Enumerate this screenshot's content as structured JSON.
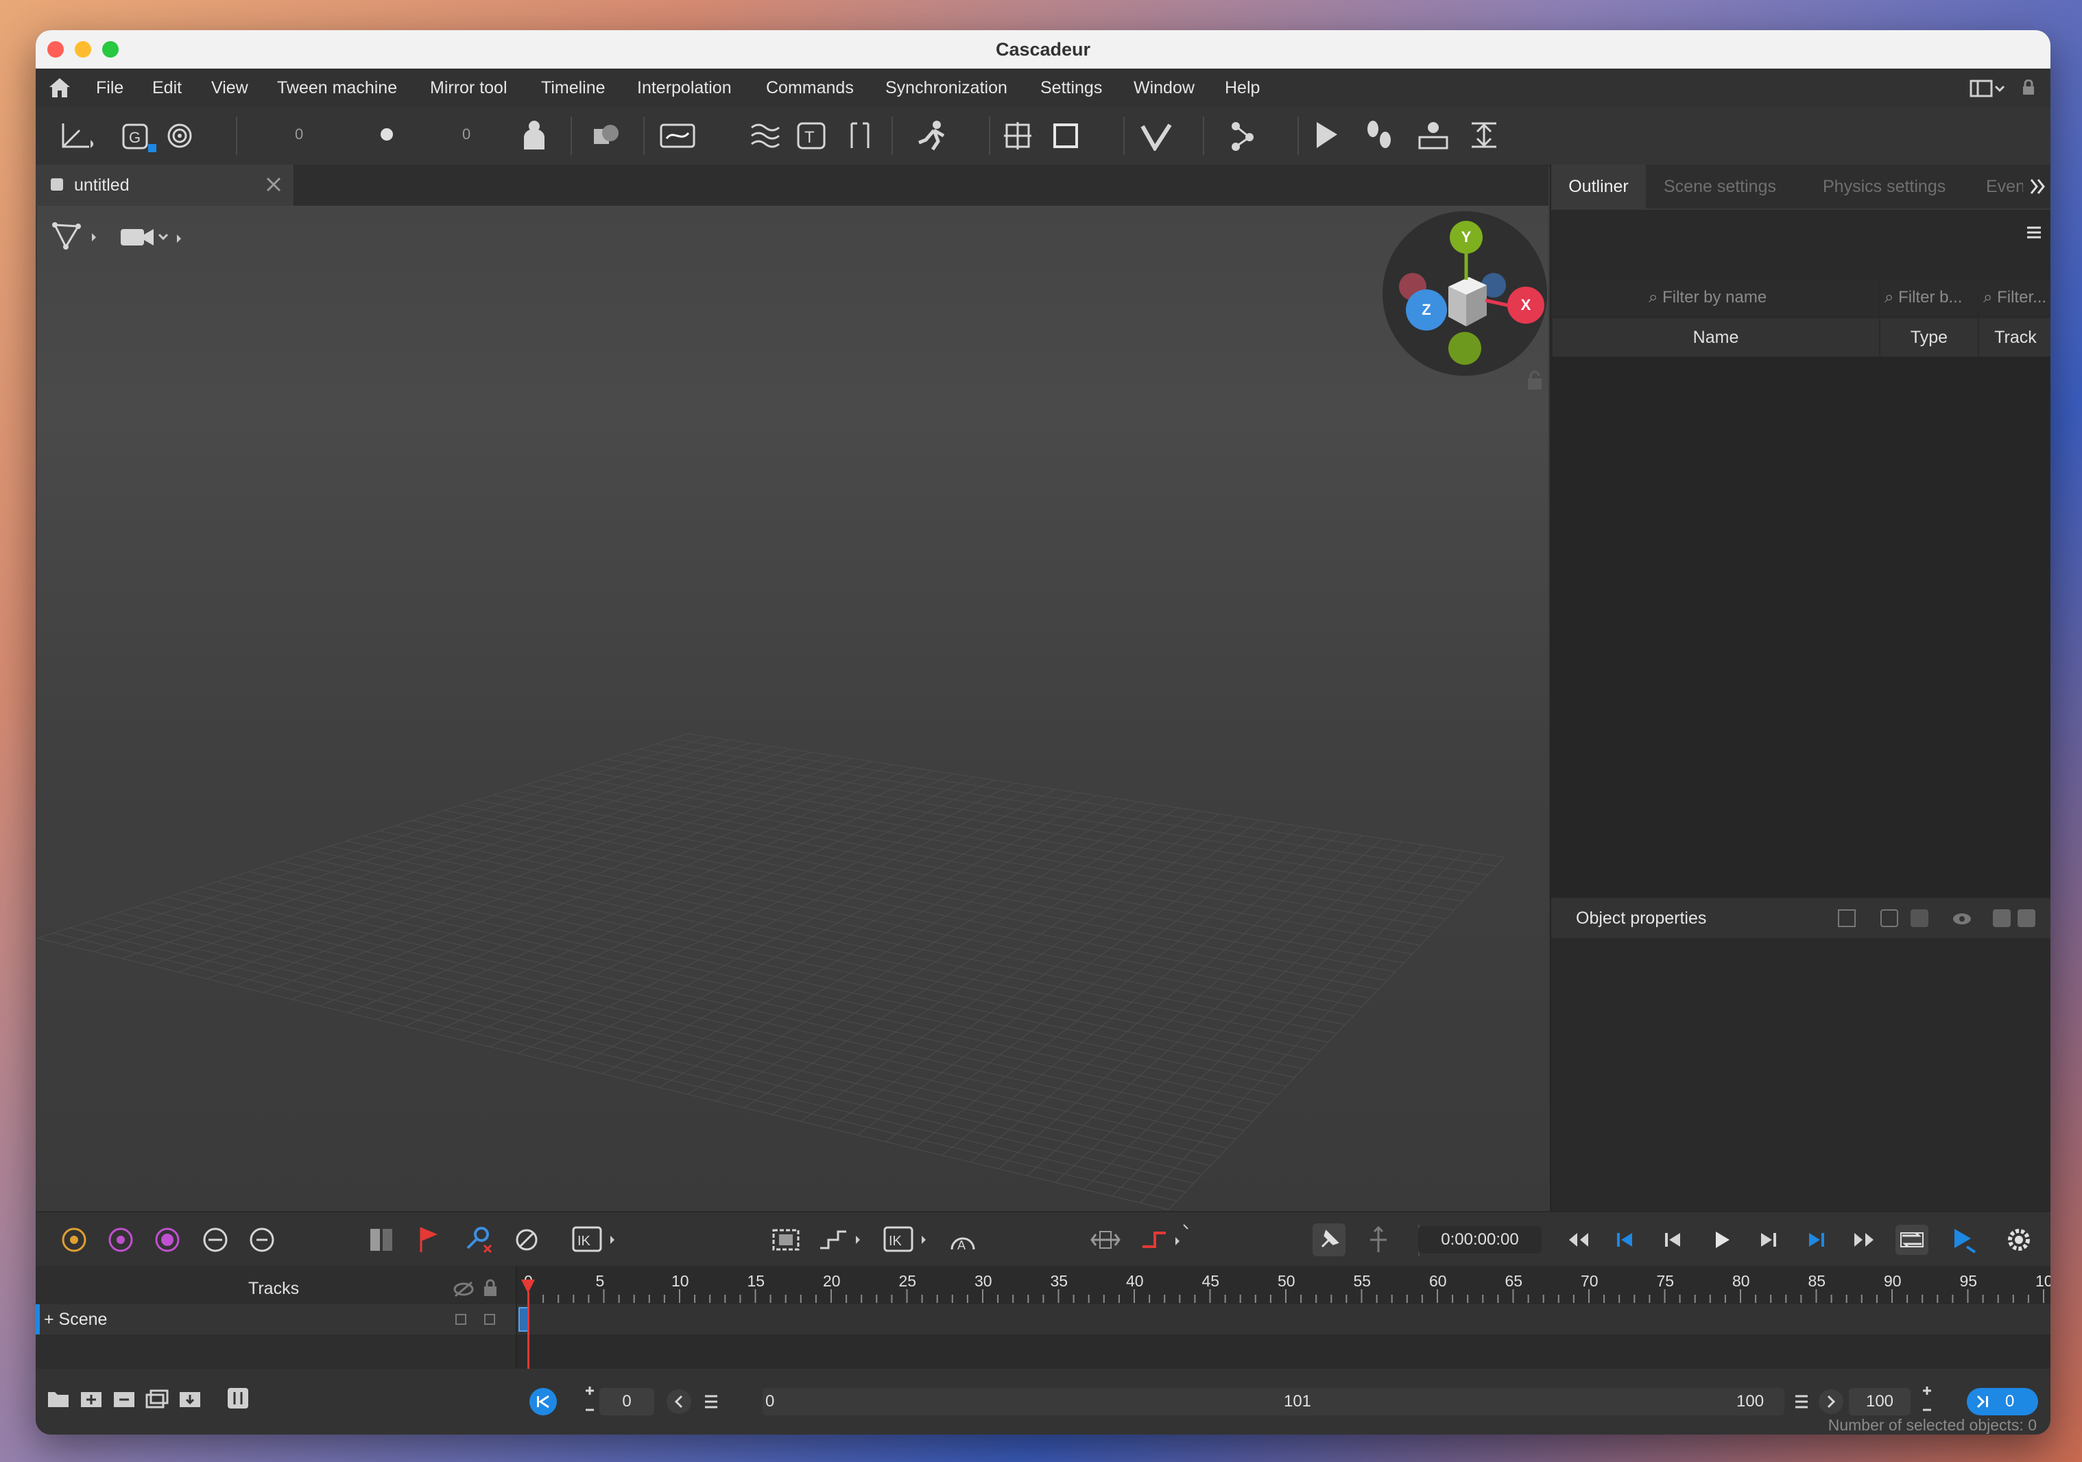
{
  "window": {
    "title": "Cascadeur"
  },
  "colors": {
    "close": "#ff5f57",
    "minimize": "#febc2e",
    "maximize": "#28c840",
    "accent": "#1e88e5",
    "playhead": "#e53935",
    "axis_x": "#e53950",
    "axis_y": "#7fb020",
    "axis_z": "#3d8fe0"
  },
  "menu": {
    "home_icon": "home-icon",
    "items": [
      "File",
      "Edit",
      "View",
      "Tween machine",
      "Mirror tool",
      "Timeline",
      "Interpolation",
      "Commands",
      "Synchronization",
      "Settings",
      "Window",
      "Help"
    ]
  },
  "toolbar": {
    "field_a": "0",
    "field_b": "0"
  },
  "tab": {
    "label": "untitled"
  },
  "gizmo": {
    "y": "Y",
    "x": "X",
    "z": "Z"
  },
  "panel": {
    "tabs": [
      "Outliner",
      "Scene settings",
      "Physics settings",
      "Even"
    ],
    "filter_name": "Filter by name",
    "filter_type": "Filter b...",
    "filter_track": "Filter...",
    "col_name": "Name",
    "col_type": "Type",
    "col_track": "Track",
    "object_properties": "Object properties"
  },
  "timeline": {
    "time": "0:00:00:00",
    "tracks_label": "Tracks",
    "scene_label": "+ Scene",
    "ticks": [
      "0",
      "5",
      "10",
      "15",
      "20",
      "25",
      "30",
      "35",
      "40",
      "45",
      "50",
      "55",
      "60",
      "65",
      "70",
      "75",
      "80",
      "85",
      "90",
      "95",
      "10"
    ]
  },
  "bottom": {
    "start": "0",
    "current": "0",
    "total": "101",
    "end": "100",
    "end2": "100",
    "loop": "0",
    "status": "Number of selected objects: 0"
  }
}
